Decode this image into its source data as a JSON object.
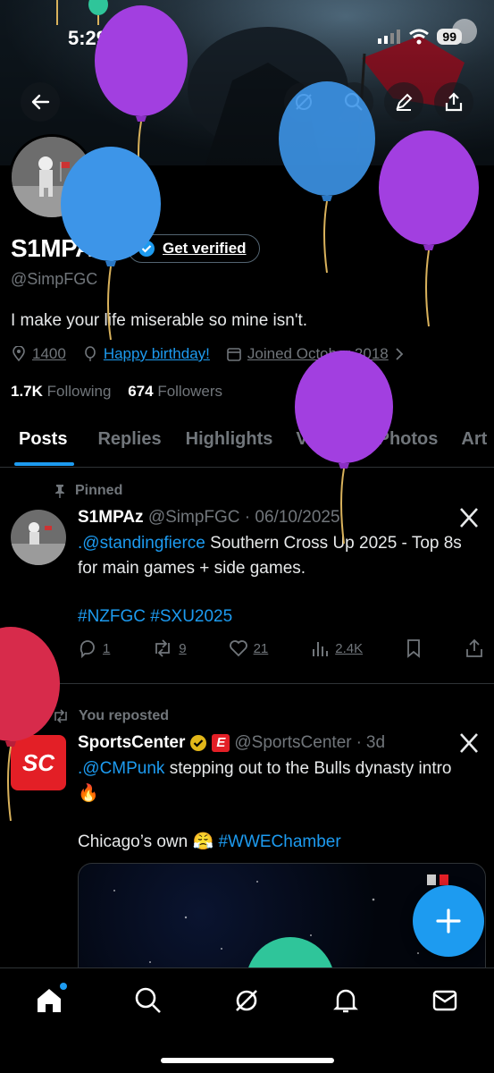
{
  "status": {
    "time": "5:29",
    "battery": "99"
  },
  "profile": {
    "display_name": "S1MPAz",
    "verify_label": "Get verified",
    "handle": "@SimpFGC",
    "bio": "I make your life miserable so mine isn't.",
    "location": "1400",
    "birthday": "Happy birthday!",
    "joined": "Joined October 2018",
    "following_count": "1.7K",
    "following_label": "Following",
    "followers_count": "674",
    "followers_label": "Followers"
  },
  "tabs": [
    "Posts",
    "Replies",
    "Highlights",
    "Videos",
    "Photos",
    "Art"
  ],
  "posts": [
    {
      "context": "Pinned",
      "name": "S1MPAz",
      "handle": "@SimpFGC",
      "date": "06/10/2025",
      "mention": ".@standingfierce",
      "text": " Southern Cross Up 2025 - Top 8s for main games + side games.",
      "hashtags": "#NZFGC #SXU2025",
      "replies": "1",
      "reposts": "9",
      "likes": "21",
      "views": "2.4K"
    },
    {
      "context": "You reposted",
      "name": "SportsCenter",
      "handle": "@SportsCenter",
      "date": "3d",
      "mention": ".@CMPunk",
      "text": " stepping out to the Bulls dynasty intro 🔥",
      "text2": "Chicago’s own 😤 ",
      "hashtag2": "#WWEChamber",
      "avatar_text": "SC"
    }
  ],
  "colors": {
    "accent": "#1d9bf0",
    "purple_balloon": "#a23fe0",
    "blue_balloon": "#3d95e8",
    "red_balloon": "#d72b4b"
  }
}
